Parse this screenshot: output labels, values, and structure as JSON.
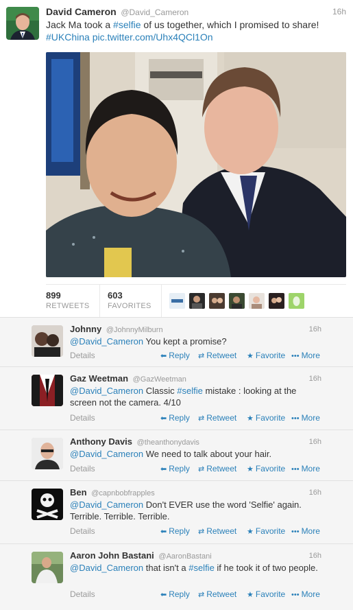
{
  "main_tweet": {
    "name": "David Cameron",
    "handle": "@David_Cameron",
    "time": "16h",
    "text_pre": "Jack Ma took a ",
    "text_hashtag": "#selfie",
    "text_post": " of us together, which I promised to share!",
    "text_hashtag2": "#UKChina",
    "text_link": "pic.twitter.com/Uhx4QCl1On",
    "retweets_count": "899",
    "retweets_label": "RETWEETS",
    "favorites_count": "603",
    "favorites_label": "FAVORITES"
  },
  "actions": {
    "details": "Details",
    "reply": "Reply",
    "retweet": "Retweet",
    "favorite": "Favorite",
    "more": "More"
  },
  "replies": [
    {
      "name": "Johnny",
      "handle": "@JohnnyMilburn",
      "time": "16h",
      "mention": "@David_Cameron",
      "text": " You kept a promise?"
    },
    {
      "name": "Gaz Weetman",
      "handle": "@GazWeetman",
      "time": "16h",
      "mention": "@David_Cameron",
      "text_pre": " Classic ",
      "hashtag": "#selfie",
      "text_post": " mistake : looking at the screen not the camera. 4/10"
    },
    {
      "name": "Anthony Davis",
      "handle": "@theanthonydavis",
      "time": "16h",
      "mention": "@David_Cameron",
      "text": " We need to talk about your hair."
    },
    {
      "name": "Ben",
      "handle": "@capnbobfrapples",
      "time": "16h",
      "mention": "@David_Cameron",
      "text": " Don't EVER use the word 'Selfie' again. Terrible. Terrible. Terrible."
    },
    {
      "name": "Aaron John Bastani",
      "handle": "@AaronBastani",
      "time": "16h",
      "mention": "@David_Cameron",
      "text_pre": " that isn't a ",
      "hashtag": "#selfie",
      "text_post": " if he took it of two people."
    }
  ],
  "colors": {
    "link": "#2a80b9",
    "muted": "#999999",
    "reply_bg": "#f5f5f5"
  }
}
